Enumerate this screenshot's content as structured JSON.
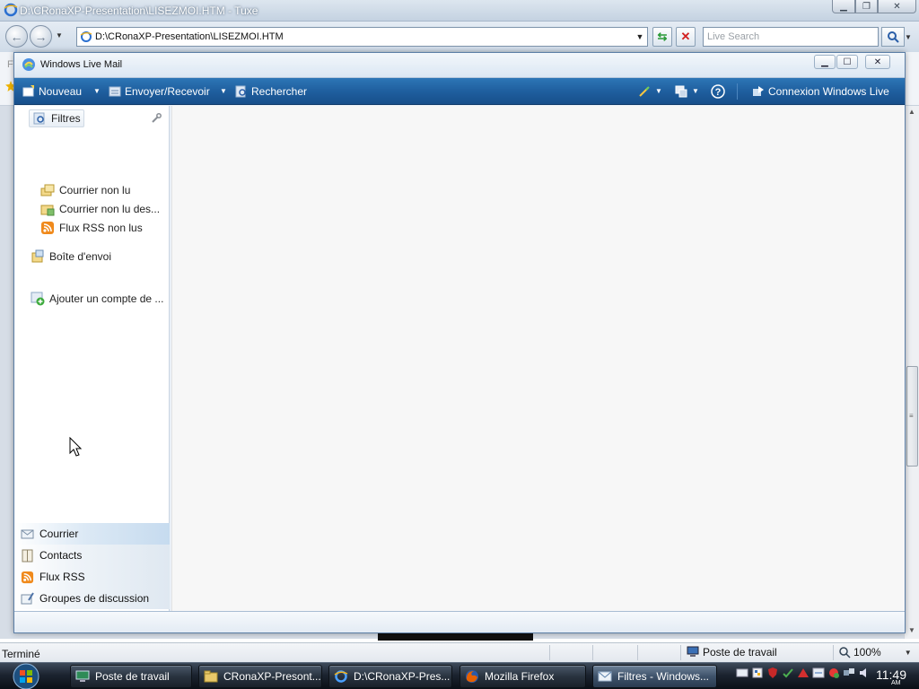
{
  "ie": {
    "title": "D:\\CRonaXP-Presentation\\LISEZMOI.HTM - Tuxe",
    "address": "D:\\CRonaXP-Presentation\\LISEZMOI.HTM",
    "search_placeholder": "Live Search",
    "favbar_fragment": "F"
  },
  "wlm": {
    "title": "Windows Live Mail",
    "toolbar": {
      "new_label": "Nouveau",
      "send_receive_label": "Envoyer/Recevoir",
      "search_label": "Rechercher",
      "connect_label": "Connexion Windows Live"
    },
    "nav": {
      "filters_header": "Filtres",
      "filters": [
        {
          "label": "Courrier non lu",
          "icon": "unread-mail-icon"
        },
        {
          "label": "Courrier non lu des...",
          "icon": "unread-contacts-mail-icon"
        },
        {
          "label": "Flux RSS non lus",
          "icon": "rss-icon"
        }
      ],
      "outbox_label": "Boîte d'envoi",
      "add_account_label": "Ajouter un compte de ..."
    },
    "sections": [
      {
        "label": "Courrier",
        "icon": "mail-icon"
      },
      {
        "label": "Contacts",
        "icon": "contacts-icon"
      },
      {
        "label": "Flux RSS",
        "icon": "rss-icon"
      },
      {
        "label": "Groupes de discussion",
        "icon": "newsgroup-icon"
      }
    ]
  },
  "statusbar": {
    "status": "Terminé",
    "zone": "Poste de travail",
    "zoom": "100%"
  },
  "taskbar": {
    "tasks": [
      {
        "label": "Poste de travail",
        "icon": "computer-icon"
      },
      {
        "label": "CRonaXP-Presont...",
        "icon": "folder-icon"
      },
      {
        "label": "D:\\CRonaXP-Pres...",
        "icon": "ie-icon"
      },
      {
        "label": "Mozilla Firefox",
        "icon": "firefox-icon"
      },
      {
        "label": "Filtres - Windows...",
        "icon": "wlm-icon"
      }
    ],
    "clock_time": "11:49",
    "clock_ampm": "AM"
  },
  "colors": {
    "wlm_toolbar": "#1f5f9f",
    "taskbar": "#1c2430",
    "accent_blue": "#2d76b6"
  }
}
